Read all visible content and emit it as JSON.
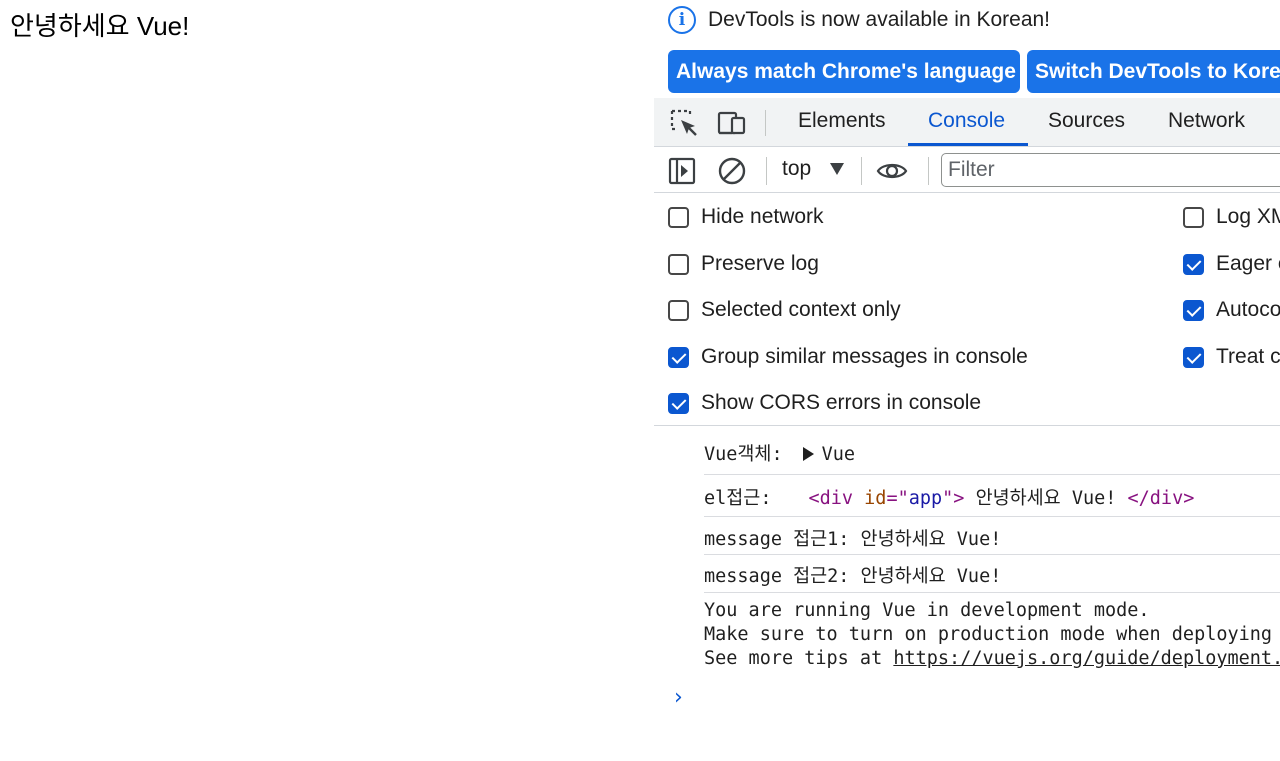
{
  "page": {
    "text": "안녕하세요 Vue!"
  },
  "infobar": {
    "icon": "info-icon",
    "icon_glyph": "i",
    "message": "DevTools is now available in Korean!",
    "primary_button": "Always match Chrome's language",
    "secondary_button": "Switch DevTools to Korean"
  },
  "tabs": {
    "inspect_icon": "inspect-element-icon",
    "device_icon": "device-toolbar-icon",
    "items": [
      "Elements",
      "Console",
      "Sources",
      "Network"
    ],
    "active": "Console"
  },
  "toolbar": {
    "sidebar_icon": "sidebar-toggle-icon",
    "clear_icon": "clear-console-icon",
    "context": "top",
    "eye_icon": "live-expression-eye-icon",
    "filter_placeholder": "Filter"
  },
  "settings": {
    "left": [
      {
        "label": "Hide network",
        "checked": false
      },
      {
        "label": "Preserve log",
        "checked": false
      },
      {
        "label": "Selected context only",
        "checked": false
      },
      {
        "label": "Group similar messages in console",
        "checked": true
      },
      {
        "label": "Show CORS errors in console",
        "checked": true
      }
    ],
    "right": [
      {
        "label": "Log XMLHttpRequests",
        "checked": false
      },
      {
        "label": "Eager evaluation",
        "checked": true
      },
      {
        "label": "Autocomplete from history",
        "checked": true
      },
      {
        "label": "Treat code evaluation as user action",
        "checked": true
      }
    ]
  },
  "console": {
    "msg1_label": "Vue객체:",
    "msg1_object": "Vue",
    "msg2_label": "el접근:",
    "msg2_tag_open": "<div",
    "msg2_attr_name": "id",
    "msg2_attr_eq": "=\"",
    "msg2_attr_value": "app",
    "msg2_attr_close": "\">",
    "msg2_text": " 안녕하세요 Vue! ",
    "msg2_tag_close": "</div>",
    "msg3": "message 접근1: 안녕하세요 Vue!",
    "msg4": "message 접근2: 안녕하세요 Vue!",
    "msg5_line1": "You are running Vue in development mode.",
    "msg5_line2": "Make sure to turn on production mode when deploying for production.",
    "msg5_line3_prefix": "See more tips at ",
    "msg5_link": "https://vuejs.org/guide/deployment.html",
    "prompt": "›"
  },
  "colors": {
    "accent": "#0b57d0",
    "button_blue": "#1a73e8",
    "tab_bar_bg": "#f1f3f4",
    "html_tag": "#881280",
    "html_attr": "#994500",
    "html_attr_value": "#1a1aa6"
  }
}
